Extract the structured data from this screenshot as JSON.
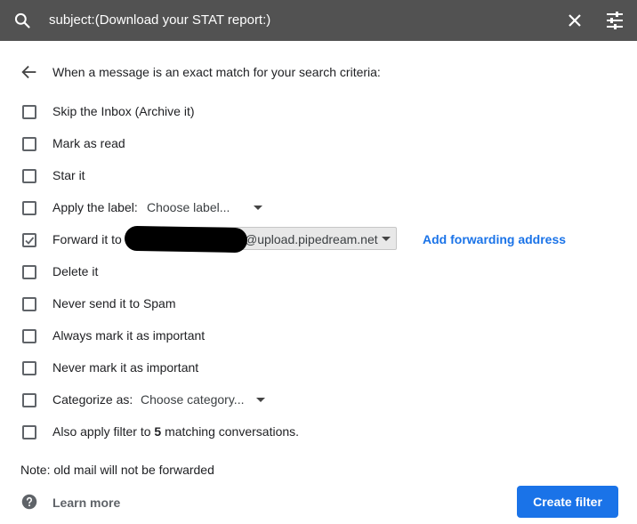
{
  "search": {
    "query": "subject:(Download your STAT report:)"
  },
  "header": {
    "text": "When a message is an exact match for your search criteria:"
  },
  "options": [
    {
      "label": "Skip the Inbox (Archive it)",
      "checked": false
    },
    {
      "label": "Mark as read",
      "checked": false
    },
    {
      "label": "Star it",
      "checked": false
    },
    {
      "label": "Apply the label:",
      "checked": false,
      "select_value": "Choose label..."
    },
    {
      "label": "Forward it to",
      "checked": true,
      "select_value": "@upload.pipedream.net",
      "link": "Add forwarding address"
    },
    {
      "label": "Delete it",
      "checked": false
    },
    {
      "label": "Never send it to Spam",
      "checked": false
    },
    {
      "label": "Always mark it as important",
      "checked": false
    },
    {
      "label": "Never mark it as important",
      "checked": false
    },
    {
      "label": "Categorize as:",
      "checked": false,
      "select_value": "Choose category..."
    },
    {
      "label_prefix": "Also apply filter to ",
      "count": "5",
      "label_suffix": " matching conversations.",
      "checked": false
    }
  ],
  "note": "Note: old mail will not be forwarded",
  "learn_more": "Learn more",
  "create_button": "Create filter",
  "colors": {
    "topbar": "#525252",
    "accent": "#1a73e8"
  },
  "icons": [
    "search-icon",
    "close-icon",
    "tune-icon",
    "arrow-back-icon",
    "checkbox-icon",
    "checkmark-icon",
    "help-icon",
    "caret-down-icon"
  ]
}
